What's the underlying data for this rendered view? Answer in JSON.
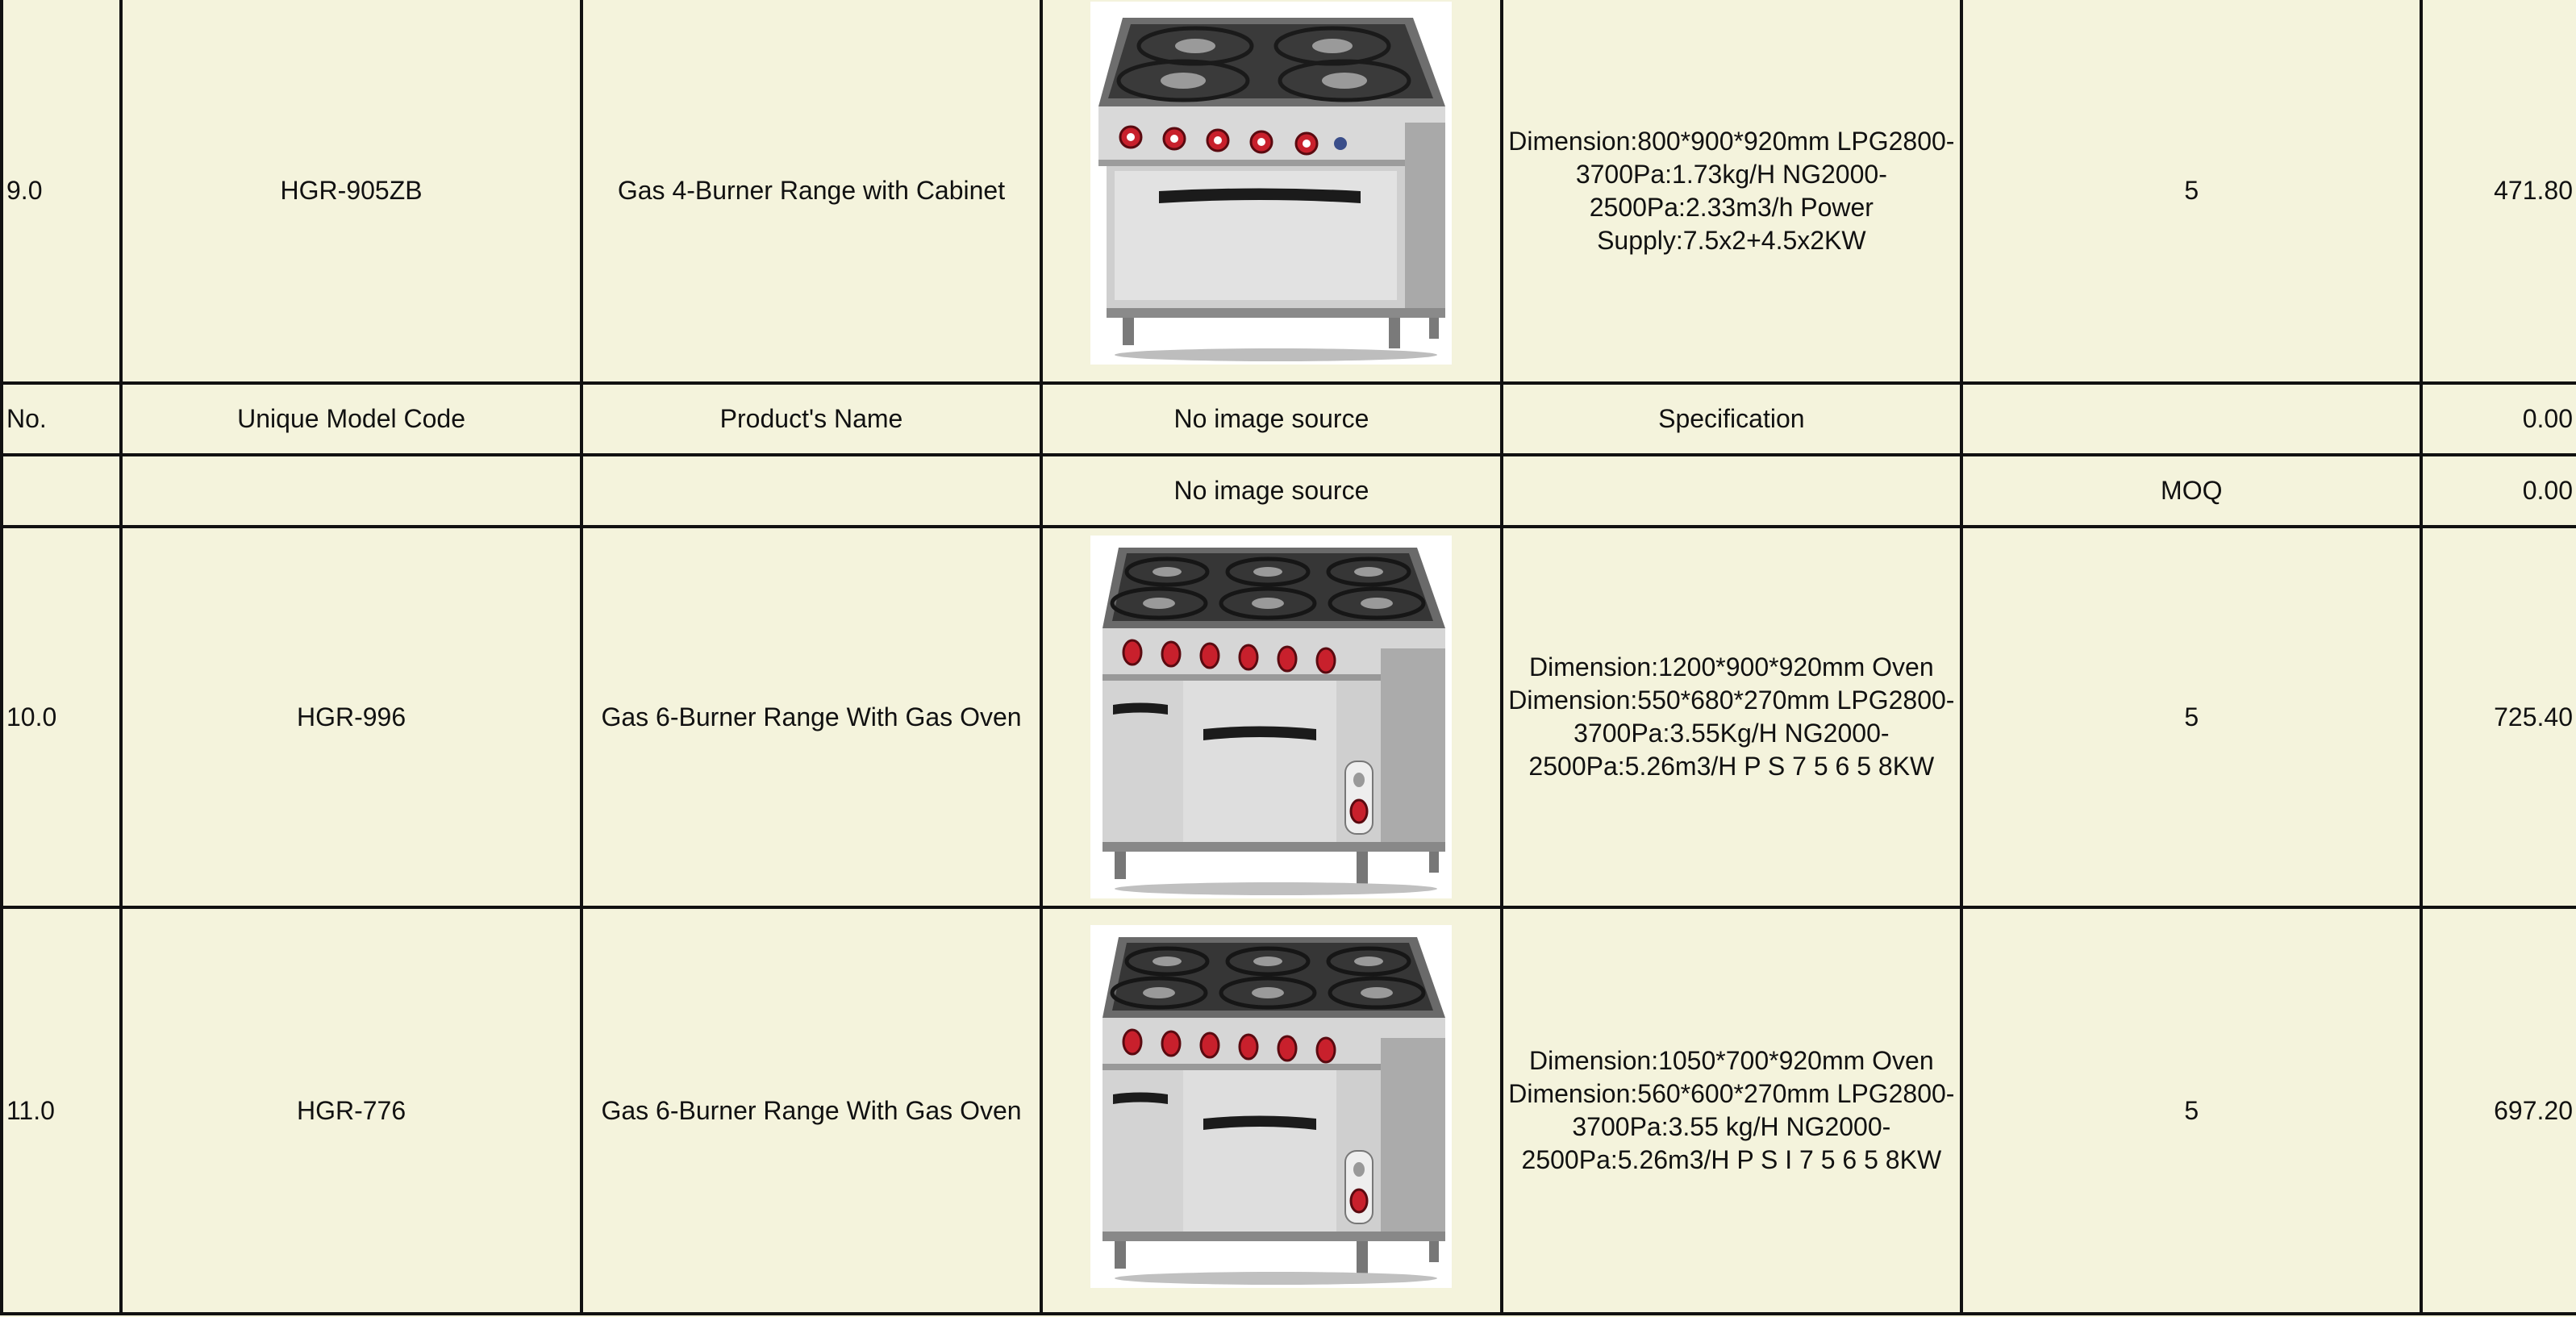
{
  "rows": [
    {
      "no": "9.0",
      "code": "HGR-905ZB",
      "name": "Gas 4-Burner Range with Cabinet",
      "image": "gas-4-burner-range-with-cabinet-image",
      "spec": "Dimension:800*900*920mm LPG2800-3700Pa:1.73kg/H NG2000-2500Pa:2.33m3/h Power Supply:7.5x2+4.5x2KW",
      "moq": "5",
      "price": "471.80"
    },
    {
      "no": "No.",
      "code": "Unique Model Code",
      "name": "Product's Name",
      "image": "No image source",
      "spec": "Specification",
      "moq": "",
      "price": "0.00"
    },
    {
      "no": "",
      "code": "",
      "name": "",
      "image": "No image source",
      "spec": "",
      "moq": "MOQ",
      "price": "0.00"
    },
    {
      "no": "10.0",
      "code": "HGR-996",
      "name": "Gas 6-Burner Range With Gas Oven",
      "image": "gas-6-burner-range-with-gas-oven-image",
      "spec": "Dimension:1200*900*920mm Oven Dimension:550*680*270mm LPG2800-3700Pa:3.55Kg/H NG2000-2500Pa:5.26m3/H P S 7 5 6 5 8KW",
      "moq": "5",
      "price": "725.40"
    },
    {
      "no": "11.0",
      "code": "HGR-776",
      "name": "Gas 6-Burner Range With Gas Oven",
      "image": "gas-6-burner-range-with-gas-oven-image",
      "spec": "Dimension:1050*700*920mm Oven Dimension:560*600*270mm LPG2800-3700Pa:3.55 kg/H NG2000-2500Pa:5.26m3/H P S I 7 5 6 5 8KW",
      "moq": "5",
      "price": "697.20"
    }
  ]
}
